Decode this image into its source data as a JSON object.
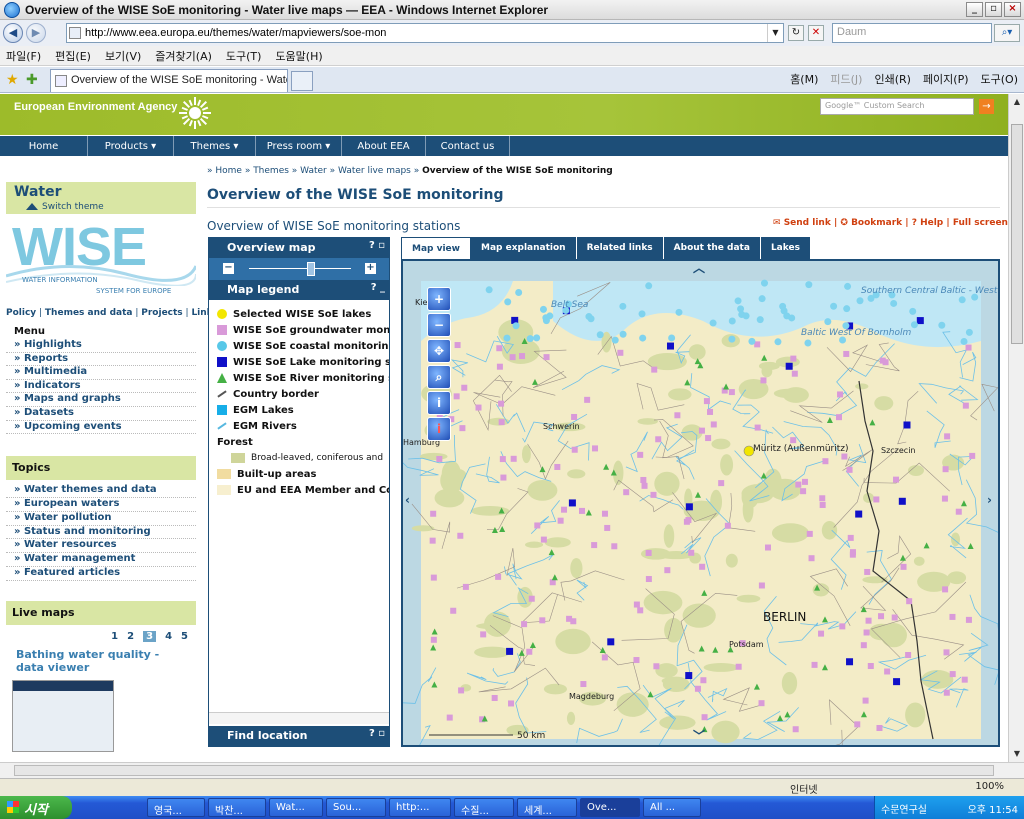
{
  "window": {
    "title": "Overview of the WISE SoE monitoring - Water live maps — EEA - Windows Internet Explorer"
  },
  "browser": {
    "url": "http://www.eea.europa.eu/themes/water/mapviewers/soe-mon",
    "search_placeholder": "Daum",
    "menu": [
      "파일(F)",
      "편집(E)",
      "보기(V)",
      "즐겨찾기(A)",
      "도구(T)",
      "도움말(H)"
    ],
    "tab_title": "Overview of the WISE SoE monitoring - Water...",
    "commands": [
      "홈(M)",
      "피드(J)",
      "인쇄(R)",
      "페이지(P)",
      "도구(O)"
    ]
  },
  "site": {
    "org": "European Environment Agency",
    "search_placeholder": "Google™ Custom Search",
    "nav": [
      "Home",
      "Products ▾",
      "Themes ▾",
      "Press room ▾",
      "About EEA",
      "Contact us"
    ]
  },
  "left": {
    "section_title": "Water",
    "switch_theme": "Switch theme",
    "logo_word": "WISE",
    "logo_line1": "WATER INFORMATION",
    "logo_line2": "SYSTEM FOR EUROPE",
    "sublinks": [
      "Policy",
      "Themes and data",
      "Projects",
      "Links"
    ],
    "menu_title": "Menu",
    "menu": [
      "» Highlights",
      "» Reports",
      "» Multimedia",
      "» Indicators",
      "» Maps and graphs",
      "» Datasets",
      "» Upcoming events"
    ],
    "topics_title": "Topics",
    "topics": [
      "» Water themes and data",
      "» European waters",
      "» Water pollution",
      "» Status and monitoring",
      "» Water resources",
      "» Water management",
      "» Featured articles"
    ],
    "livemaps_title": "Live maps",
    "pages": [
      "1",
      "2",
      "3",
      "4",
      "5"
    ],
    "current_page": "3",
    "bathing_title": "Bathing water quality - data viewer"
  },
  "content": {
    "breadcrumb": [
      "Home",
      "Themes",
      "Water",
      "Water live maps"
    ],
    "breadcrumb_current": "Overview of the WISE SoE monitoring",
    "title": "Overview of the WISE SoE monitoring",
    "subtitle": "Overview of WISE SoE monitoring stations",
    "links": [
      "Send link",
      "Bookmark",
      "Help",
      "Full screen"
    ]
  },
  "panel": {
    "overview_title": "Overview map",
    "legend_title": "Map legend",
    "find_title": "Find location",
    "legend": [
      {
        "label": "Selected WISE SoE lakes",
        "color": "#f2e600",
        "shape": "circle"
      },
      {
        "label": "WISE SoE groundwater monito",
        "color": "#d99ad9",
        "shape": "square"
      },
      {
        "label": "WISE SoE coastal monitoring s",
        "color": "#58c8e8",
        "shape": "circle"
      },
      {
        "label": "WISE SoE Lake monitoring sta",
        "color": "#1010c8",
        "shape": "square"
      },
      {
        "label": "WISE SoE River monitoring sta",
        "color": "#45b045",
        "shape": "triangle"
      },
      {
        "label": "Country border",
        "color": "#555555",
        "shape": "line"
      },
      {
        "label": "EGM Lakes",
        "color": "#17aee8",
        "shape": "square"
      },
      {
        "label": "EGM Rivers",
        "color": "#57b8e0",
        "shape": "line"
      }
    ],
    "forest_title": "Forest",
    "legend2": [
      {
        "label": "Broad-leaved, coniferous and",
        "color": "#cfd59a",
        "sub": true
      },
      {
        "label": "Built-up areas",
        "color": "#f1dca0",
        "sub": false
      },
      {
        "label": "EU and EEA Member and Coll",
        "color": "#f7efcf",
        "sub": false
      }
    ]
  },
  "map": {
    "tabs": [
      "Map view",
      "Map explanation",
      "Related links",
      "About the data",
      "Lakes"
    ],
    "labels": {
      "belt_sea": "Belt Sea",
      "southern_baltic": "Southern Central Baltic - West",
      "baltic_bornholm": "Baltic West Of Bornholm",
      "kiel": "Kiel",
      "schwerin": "Schwerin",
      "hamburg": "Hamburg",
      "muritz": "Müritz (Außenmüritz)",
      "szczecin": "Szczecin",
      "berlin": "BERLIN",
      "potsdam": "Potsdam",
      "magdeburg": "Magdeburg",
      "scale": "50 km"
    }
  },
  "status": {
    "zone": "인터넷",
    "zoom": "100%"
  },
  "taskbar": {
    "start": "시작",
    "items": [
      "영국...",
      "박찬...",
      "Wat...",
      "Sou...",
      "http:...",
      "수질...",
      "세계...",
      "Ove...",
      "All ..."
    ],
    "tray_text": "수문연구실",
    "clock": "오후 11:54"
  }
}
